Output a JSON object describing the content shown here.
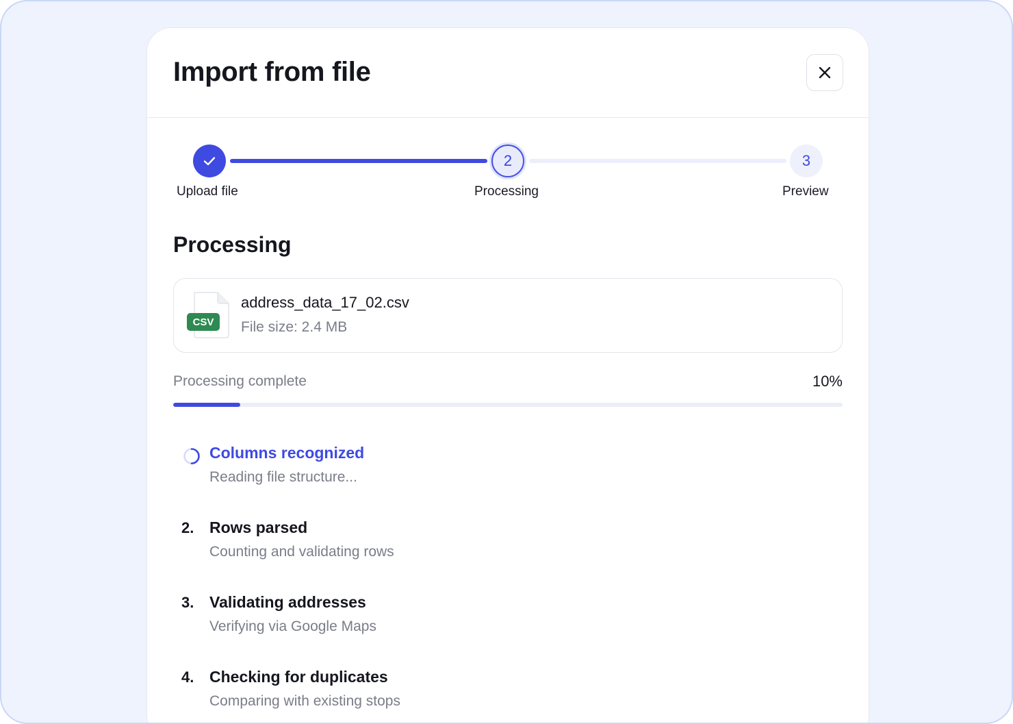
{
  "modal": {
    "title": "Import from file"
  },
  "stepper": {
    "steps": [
      {
        "label": "Upload file",
        "number": "1",
        "status": "completed"
      },
      {
        "label": "Processing",
        "number": "2",
        "status": "active"
      },
      {
        "label": "Preview",
        "number": "3",
        "status": "pending"
      }
    ]
  },
  "processing": {
    "section_title": "Processing",
    "file": {
      "badge": "CSV",
      "name": "address_data_17_02.csv",
      "size": "File size: 2.4 MB"
    },
    "progress": {
      "label": "Processing complete",
      "value_text": "10%",
      "percent": 10
    },
    "tasks": [
      {
        "marker": "",
        "title": "Columns recognized",
        "description": "Reading file structure...",
        "status": "in-progress"
      },
      {
        "marker": "2.",
        "title": "Rows parsed",
        "description": "Counting and validating rows",
        "status": "pending"
      },
      {
        "marker": "3.",
        "title": "Validating addresses",
        "description": "Verifying via Google Maps",
        "status": "pending"
      },
      {
        "marker": "4.",
        "title": "Checking for duplicates",
        "description": "Comparing with existing stops",
        "status": "pending"
      }
    ]
  },
  "colors": {
    "accent": "#3f4ae0",
    "csv_badge": "#2e8a52",
    "muted_text": "#7a7d88",
    "background": "#eef3fe"
  },
  "icons": {
    "close": "close-icon",
    "completed_step": "check-icon",
    "file": "csv-file-icon",
    "in_progress": "spinner-icon"
  }
}
